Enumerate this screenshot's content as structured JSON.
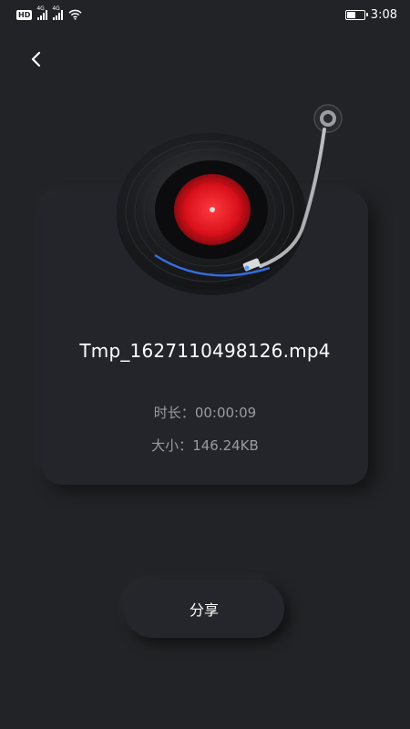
{
  "status_bar": {
    "hd": "HD",
    "sim1": "4G",
    "sim2": "4G",
    "time": "3:08"
  },
  "nav": {
    "back_icon": "chevron-left-icon"
  },
  "file": {
    "name": "Tmp_1627110498126.mp4",
    "duration_label": "时长：",
    "duration": "00:00:09",
    "size_label": "大小：",
    "size": "146.24KB"
  },
  "actions": {
    "share_label": "分享"
  },
  "colors": {
    "background": "#222326",
    "card": "#24252a",
    "record_label": "#e0141c",
    "accent_glow": "#3a7bff",
    "muted_text": "#9a9ba0"
  }
}
